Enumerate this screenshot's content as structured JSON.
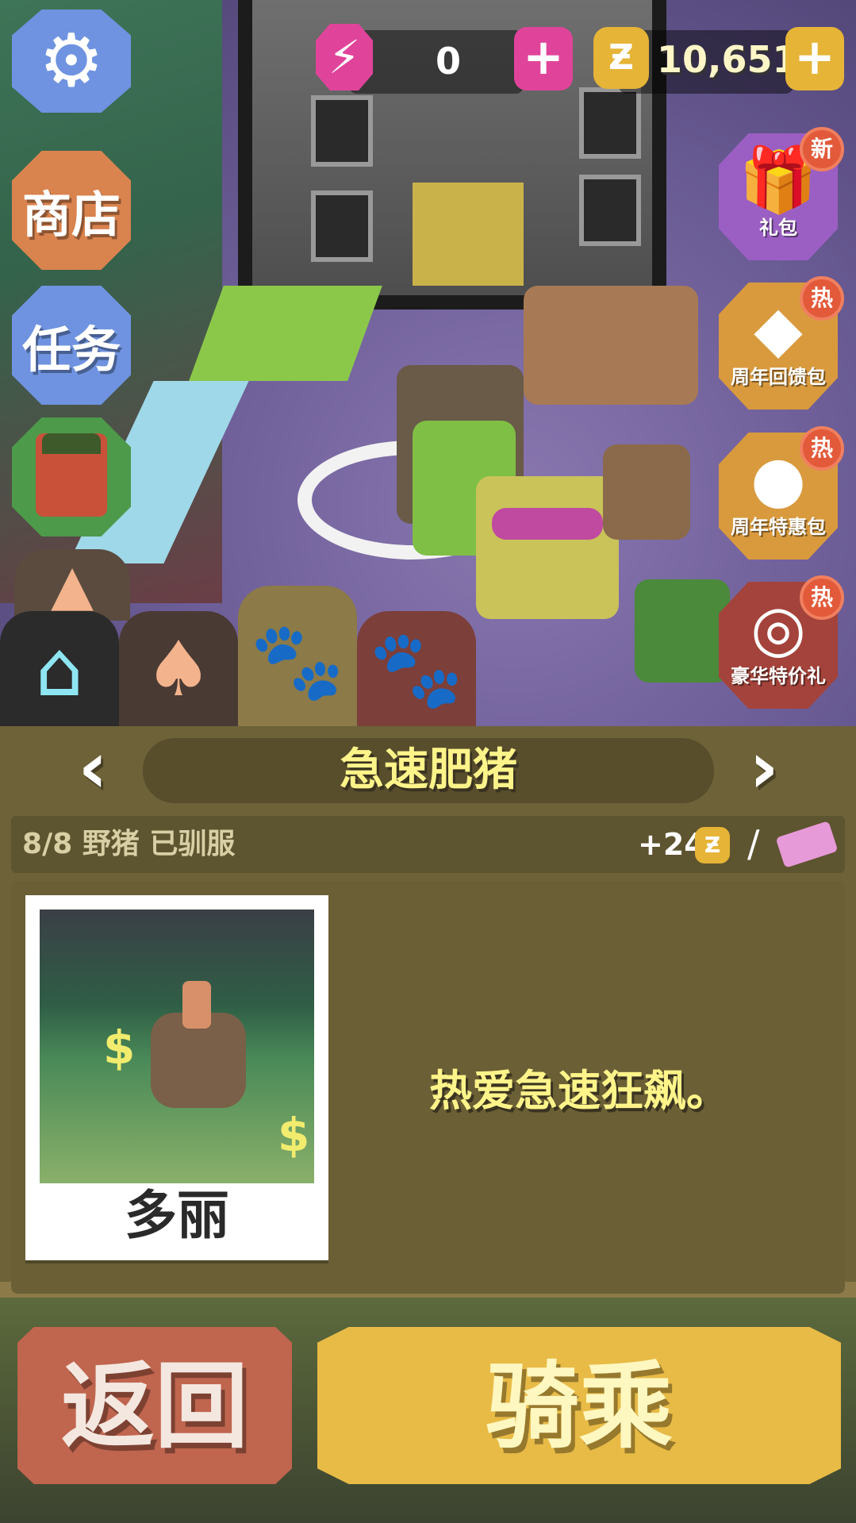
{
  "hud": {
    "energy_icon": "lightning-icon",
    "energy_value": "0",
    "coin_icon": "coin-icon",
    "coin_symbol": "Ƶ",
    "coin_value": "10,651",
    "plus_label": "+"
  },
  "side_menu": {
    "settings_icon": "gear-icon",
    "shop_label": "商店",
    "missions_label": "任务",
    "profile_icon": "character-portrait"
  },
  "promos": [
    {
      "label": "礼包",
      "badge": "新",
      "icon": "gift-icon",
      "color": "#9b5fc4"
    },
    {
      "label": "周年回馈包",
      "badge": "热",
      "icon": "anniversary-diamond-icon",
      "color": "#d99a3e"
    },
    {
      "label": "周年特惠包",
      "badge": "热",
      "icon": "balloons-icon",
      "color": "#d99a3e"
    },
    {
      "label": "豪华特价礼",
      "badge": "热",
      "icon": "deluxe-gift-icon",
      "color": "#a4433b"
    }
  ],
  "tabs": [
    {
      "icon": "home-icon",
      "color": "#2b2b2b",
      "glyph_color": "#8ee6f2"
    },
    {
      "icon": "cowboy-hat-icon",
      "color": "#4a3a34",
      "glyph_color": "#f3b38c"
    },
    {
      "icon": "paw-icon",
      "color": "#8c7a48",
      "glyph_color": "#3a3220",
      "selected": true
    },
    {
      "icon": "paw-outline-icon",
      "color": "#7c3f3a",
      "glyph_color": "#ffffff"
    }
  ],
  "animal": {
    "title": "急速肥猪",
    "tamed_status": "8/8 野猪 已驯服",
    "reward": "+24",
    "reward_coin": "Ƶ",
    "separator": "/",
    "name": "多丽",
    "description": "热爱急速狂飙。"
  },
  "actions": {
    "back_label": "返回",
    "ride_label": "骑乘"
  },
  "colors": {
    "panel_bg": "#6e6238",
    "title_text": "#fff48a",
    "back_button": "#c0654e",
    "ride_button": "#e8bb46",
    "settings_button": "#6f93e0",
    "shop_button": "#d9834e",
    "missions_button": "#6f93e0",
    "profile_button": "#4d9a4a"
  }
}
